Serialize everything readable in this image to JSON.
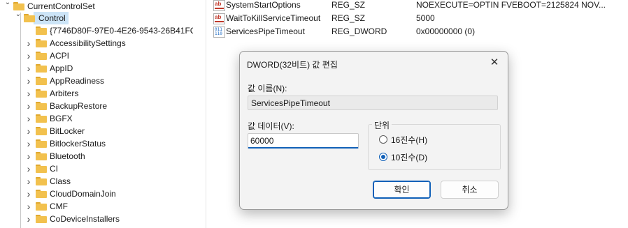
{
  "tree": {
    "root": {
      "label": "CurrentControlSet"
    },
    "selected": {
      "label": "Control"
    },
    "children": [
      "{7746D80F-97E0-4E26-9543-26B41FC",
      "AccessibilitySettings",
      "ACPI",
      "AppID",
      "AppReadiness",
      "Arbiters",
      "BackupRestore",
      "BGFX",
      "BitLocker",
      "BitlockerStatus",
      "Bluetooth",
      "CI",
      "Class",
      "CloudDomainJoin",
      "CMF",
      "CoDeviceInstallers"
    ]
  },
  "values": [
    {
      "icon": "string-value-icon",
      "name": "SystemStartOptions",
      "type": "REG_SZ",
      "data": "NOEXECUTE=OPTIN  FVEBOOT=2125824  NOV..."
    },
    {
      "icon": "string-value-icon",
      "name": "WaitToKillServiceTimeout",
      "type": "REG_SZ",
      "data": "5000"
    },
    {
      "icon": "binary-value-icon",
      "name": "ServicesPipeTimeout",
      "type": "REG_DWORD",
      "data": "0x00000000 (0)"
    }
  ],
  "dialog": {
    "title": "DWORD(32비트) 값 편집",
    "value_name_label": "값 이름(N):",
    "value_name": "ServicesPipeTimeout",
    "value_data_label": "값 데이터(V):",
    "value_data": "60000",
    "base_label": "단위",
    "radio_hex": "16진수(H)",
    "radio_dec": "10진수(D)",
    "selected_base": "dec",
    "ok_label": "확인",
    "cancel_label": "취소",
    "close_glyph": "✕"
  },
  "colors": {
    "accent": "#1060b8",
    "selection": "#cce4f7",
    "folder": "#f2c14e"
  }
}
